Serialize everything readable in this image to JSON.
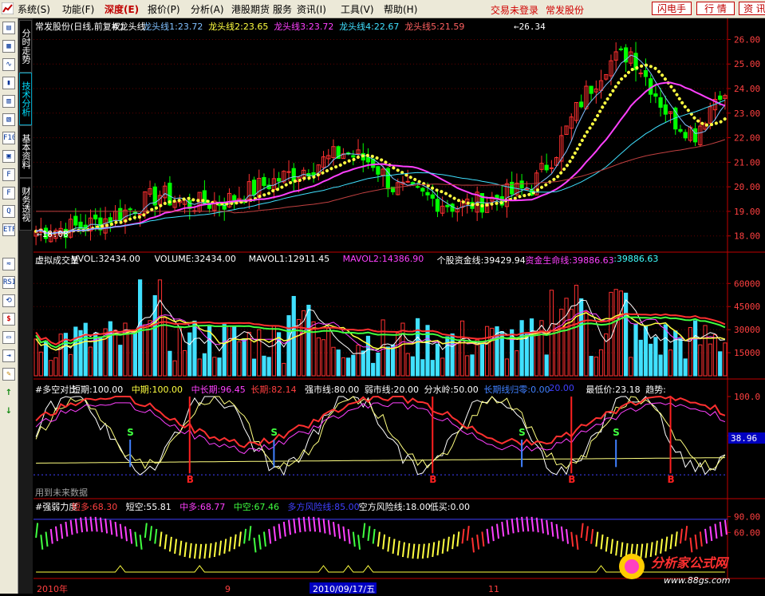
{
  "menubar": {
    "items": [
      "系统(S)",
      "功能(F)",
      "深度(E)",
      "报价(P)",
      "分析(A)",
      "港股期货",
      "服务",
      "资讯(I)",
      "工具(V)",
      "帮助(H)"
    ],
    "status_text": "交易未登录",
    "stock_name": "常发股份",
    "buttons": [
      "闪电手",
      "行 情",
      "资 讯"
    ]
  },
  "side_tabs": [
    "分时走势",
    "技术分析",
    "基本资料",
    "财务透视"
  ],
  "toolbar_icons": [
    "toolbar-icon-1",
    "toolbar-icon-2",
    "toolbar-icon-3",
    "toolbar-icon-4",
    "toolbar-icon-5",
    "toolbar-icon-6",
    "f10-icon",
    "toolbar-icon-8",
    "toolbar-icon-9",
    "toolbar-icon-10",
    "toolbar-icon-11",
    "etf-icon",
    "toolbar-icon-13",
    "rsi-icon",
    "toolbar-icon-15",
    "dollar-icon",
    "toolbar-icon-17",
    "toolbar-icon-18",
    "pencil-icon",
    "arrow-up-icon",
    "arrow-down-icon"
  ],
  "panel1": {
    "legend": [
      {
        "text": "常发股份(日线,前复权)",
        "color": "#ffffff"
      },
      {
        "text": "#龙头线",
        "color": "#ffffff"
      },
      {
        "text": "龙头线1:23.72",
        "color": "#80c0ff"
      },
      {
        "text": "龙头线2:23.65",
        "color": "#ffff40"
      },
      {
        "text": "龙头线3:23.72",
        "color": "#ff40ff"
      },
      {
        "text": "龙头线4:22.67",
        "color": "#40e0ff"
      },
      {
        "text": "龙头线5:21.59",
        "color": "#ff6060"
      }
    ],
    "y_ticks": [
      "26.00",
      "25.00",
      "24.00",
      "23.00",
      "22.00",
      "21.00",
      "20.00",
      "19.00",
      "18.00"
    ],
    "high_marker": "26.34",
    "low_marker": "18.08"
  },
  "panel2": {
    "legend": [
      {
        "text": "虚拟成交量",
        "color": "#ffffff"
      },
      {
        "text": "VVOL:32434.00",
        "color": "#ffffff"
      },
      {
        "text": "VOLUME:32434.00",
        "color": "#ffffff"
      },
      {
        "text": "MAVOL1:12911.45",
        "color": "#ffffff"
      },
      {
        "text": "MAVOL2:14386.90",
        "color": "#ff40ff"
      },
      {
        "text": "个股资金线:39429.94",
        "color": "#ffffff"
      },
      {
        "text": "资金生命线:39886.63",
        "color": "#ff40ff"
      },
      {
        "text": ":39886.63",
        "color": "#40ffff"
      }
    ],
    "y_ticks": [
      "60000",
      "45000",
      "30000",
      "15000"
    ]
  },
  "panel3": {
    "legend": [
      {
        "text": "#多空对比",
        "color": "#ffffff"
      },
      {
        "text": "短期:100.00",
        "color": "#ffffff"
      },
      {
        "text": "中期:100.00",
        "color": "#ffff40"
      },
      {
        "text": "中长期:96.45",
        "color": "#ff40ff"
      },
      {
        "text": "长期:82.14",
        "color": "#ff4040"
      },
      {
        "text": "强市线:80.00",
        "color": "#ffffff"
      },
      {
        "text": "弱市线:20.00",
        "color": "#ffffff"
      },
      {
        "text": "分水岭:50.00",
        "color": "#ffffff"
      },
      {
        "text": "长期线归零:0.00",
        "color": "#4080ff"
      },
      {
        "text": "20.00",
        "color": "#4040ff"
      },
      {
        "text": "最低价:23.18",
        "color": "#ffffff"
      },
      {
        "text": "趋势:",
        "color": "#ffffff"
      }
    ],
    "y_ticks": [
      "100.0",
      "50.0"
    ],
    "current_value": "38.96",
    "future_data_note": "用到未来数据",
    "signal_s": "S",
    "signal_b": "B"
  },
  "panel4": {
    "legend": [
      {
        "text": "#强弱力度",
        "color": "#ffffff"
      },
      {
        "text": "短多:68.30",
        "color": "#ff4040"
      },
      {
        "text": "短空:55.81",
        "color": "#ffffff"
      },
      {
        "text": "中多:68.77",
        "color": "#ff40ff"
      },
      {
        "text": "中空:67.46",
        "color": "#40ff40"
      },
      {
        "text": "多方风险线:85.00",
        "color": "#4040ff"
      },
      {
        "text": "空方风险线:18.00",
        "color": "#ffffff"
      },
      {
        "text": "低买:0.00",
        "color": "#ffffff"
      }
    ],
    "y_ticks": [
      "90.00",
      "60.00"
    ]
  },
  "date_axis": {
    "start": "2010年",
    "tick_9": "9",
    "cursor_date": "2010/09/17/五",
    "tick_11": "11"
  },
  "watermark": {
    "brand": "分析家公式网",
    "url": "www.88gs.com"
  },
  "colors": {
    "up": "#ff3030",
    "down": "#00e0e0",
    "down_candle": "#00ff00",
    "axis": "#c00000",
    "grid": "#800000"
  }
}
